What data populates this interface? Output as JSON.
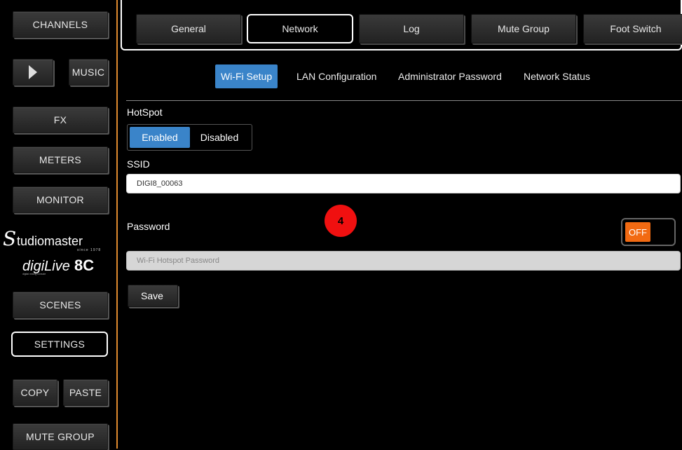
{
  "sidebar": {
    "channels": "CHANNELS",
    "music": "MUSIC",
    "fx": "FX",
    "meters": "METERS",
    "monitor": "MONITOR",
    "brand_name": "Studiomaster",
    "brand_since": "since 1978",
    "brand_product": "digiLive 8C",
    "scenes": "SCENES",
    "settings": "SETTINGS",
    "copy": "COPY",
    "paste": "PASTE",
    "mute_group": "MUTE GROUP"
  },
  "tabs": [
    {
      "label": "General"
    },
    {
      "label": "Network"
    },
    {
      "label": "Log"
    },
    {
      "label": "Mute Group"
    },
    {
      "label": "Foot Switch"
    }
  ],
  "subtabs": [
    {
      "label": "Wi-Fi Setup"
    },
    {
      "label": "LAN Configuration"
    },
    {
      "label": "Administrator Password"
    },
    {
      "label": "Network Status"
    }
  ],
  "hotspot": {
    "label": "HotSpot",
    "enabled": "Enabled",
    "disabled": "Disabled"
  },
  "ssid": {
    "label": "SSID",
    "value": "DIGI8_00063"
  },
  "password": {
    "label": "Password",
    "placeholder": "Wi-Fi Hotspot Password",
    "toggle": "OFF"
  },
  "badge": "4",
  "save": "Save",
  "colors": {
    "accent": "#3a84c9",
    "sidebar_border": "#e08a2e",
    "toggle_off": "#f26a12",
    "badge": "#f01010"
  }
}
